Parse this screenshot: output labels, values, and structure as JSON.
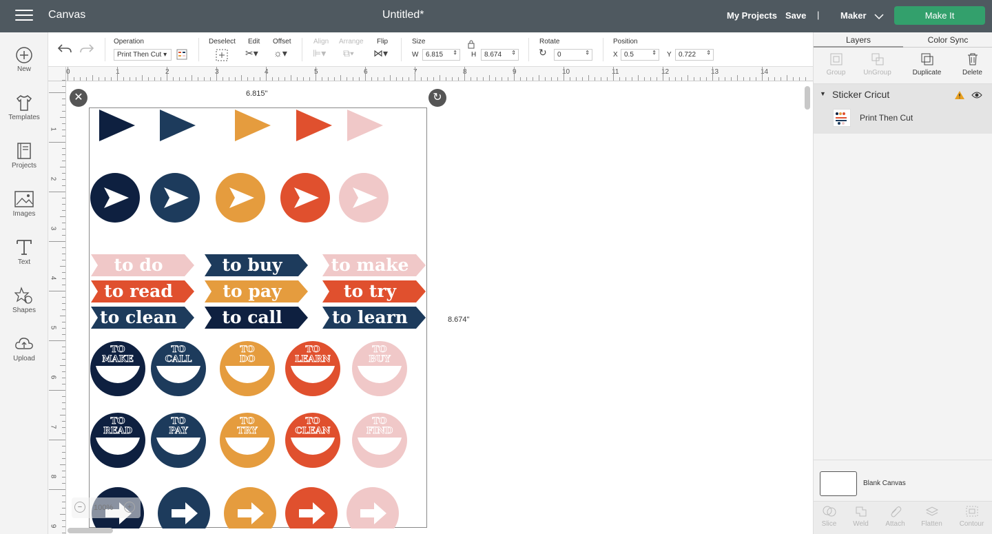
{
  "header": {
    "app_name": "Canvas",
    "doc_title": "Untitled*",
    "my_projects": "My Projects",
    "save": "Save",
    "divider": "|",
    "machine": "Maker",
    "make_it": "Make It"
  },
  "left_nav": [
    {
      "label": "New",
      "icon": "plus-circle-icon"
    },
    {
      "label": "Templates",
      "icon": "tshirt-icon"
    },
    {
      "label": "Projects",
      "icon": "book-icon"
    },
    {
      "label": "Images",
      "icon": "image-icon"
    },
    {
      "label": "Text",
      "icon": "text-t-icon"
    },
    {
      "label": "Shapes",
      "icon": "shapes-icon"
    },
    {
      "label": "Upload",
      "icon": "cloud-upload-icon"
    }
  ],
  "toolbar": {
    "operation_label": "Operation",
    "operation_value": "Print Then Cut",
    "deselect_label": "Deselect",
    "edit_label": "Edit",
    "offset_label": "Offset",
    "align_label": "Align",
    "arrange_label": "Arrange",
    "flip_label": "Flip",
    "size_label": "Size",
    "w_label": "W",
    "w_value": "6.815",
    "h_label": "H",
    "h_value": "8.674",
    "rotate_label": "Rotate",
    "rotate_value": "0",
    "position_label": "Position",
    "x_label": "X",
    "x_value": "0.5",
    "y_label": "Y",
    "y_value": "0.722"
  },
  "ruler": {
    "h": [
      "0",
      "1",
      "2",
      "3",
      "4",
      "5",
      "6",
      "7",
      "8",
      "9",
      "10",
      "11",
      "12",
      "13",
      "14",
      "1"
    ],
    "v": [
      "1",
      "2",
      "3",
      "4",
      "5",
      "6",
      "7",
      "8",
      "9"
    ]
  },
  "canvas": {
    "width_label": "6.815\"",
    "height_label": "8.674\"",
    "zoom": "100%"
  },
  "stickers": {
    "banners": [
      [
        "to do",
        "to buy",
        "to make"
      ],
      [
        "to read",
        "to pay",
        "to try"
      ],
      [
        "to clean",
        "to call",
        "to learn"
      ]
    ],
    "badges_row1": [
      "TO MAKE",
      "TO CALL",
      "TO DO",
      "TO LEARN",
      "TO BUY"
    ],
    "badges_row2": [
      "TO READ",
      "TO PAY",
      "TO TRY",
      "TO CLEAN",
      "TO FIND"
    ],
    "colors": {
      "navy": "#0e2040",
      "slate": "#1d3b5c",
      "mustard": "#e59c3e",
      "red": "#e0502e",
      "pink": "#f0c8c8"
    }
  },
  "right_panel": {
    "tabs": [
      "Layers",
      "Color Sync"
    ],
    "tools": [
      "Group",
      "UnGroup",
      "Duplicate",
      "Delete"
    ],
    "layer_group": "Sticker Cricut",
    "layer_item": "Print Then Cut",
    "blank_canvas": "Blank Canvas",
    "bottom_tools": [
      "Slice",
      "Weld",
      "Attach",
      "Flatten",
      "Contour"
    ]
  }
}
